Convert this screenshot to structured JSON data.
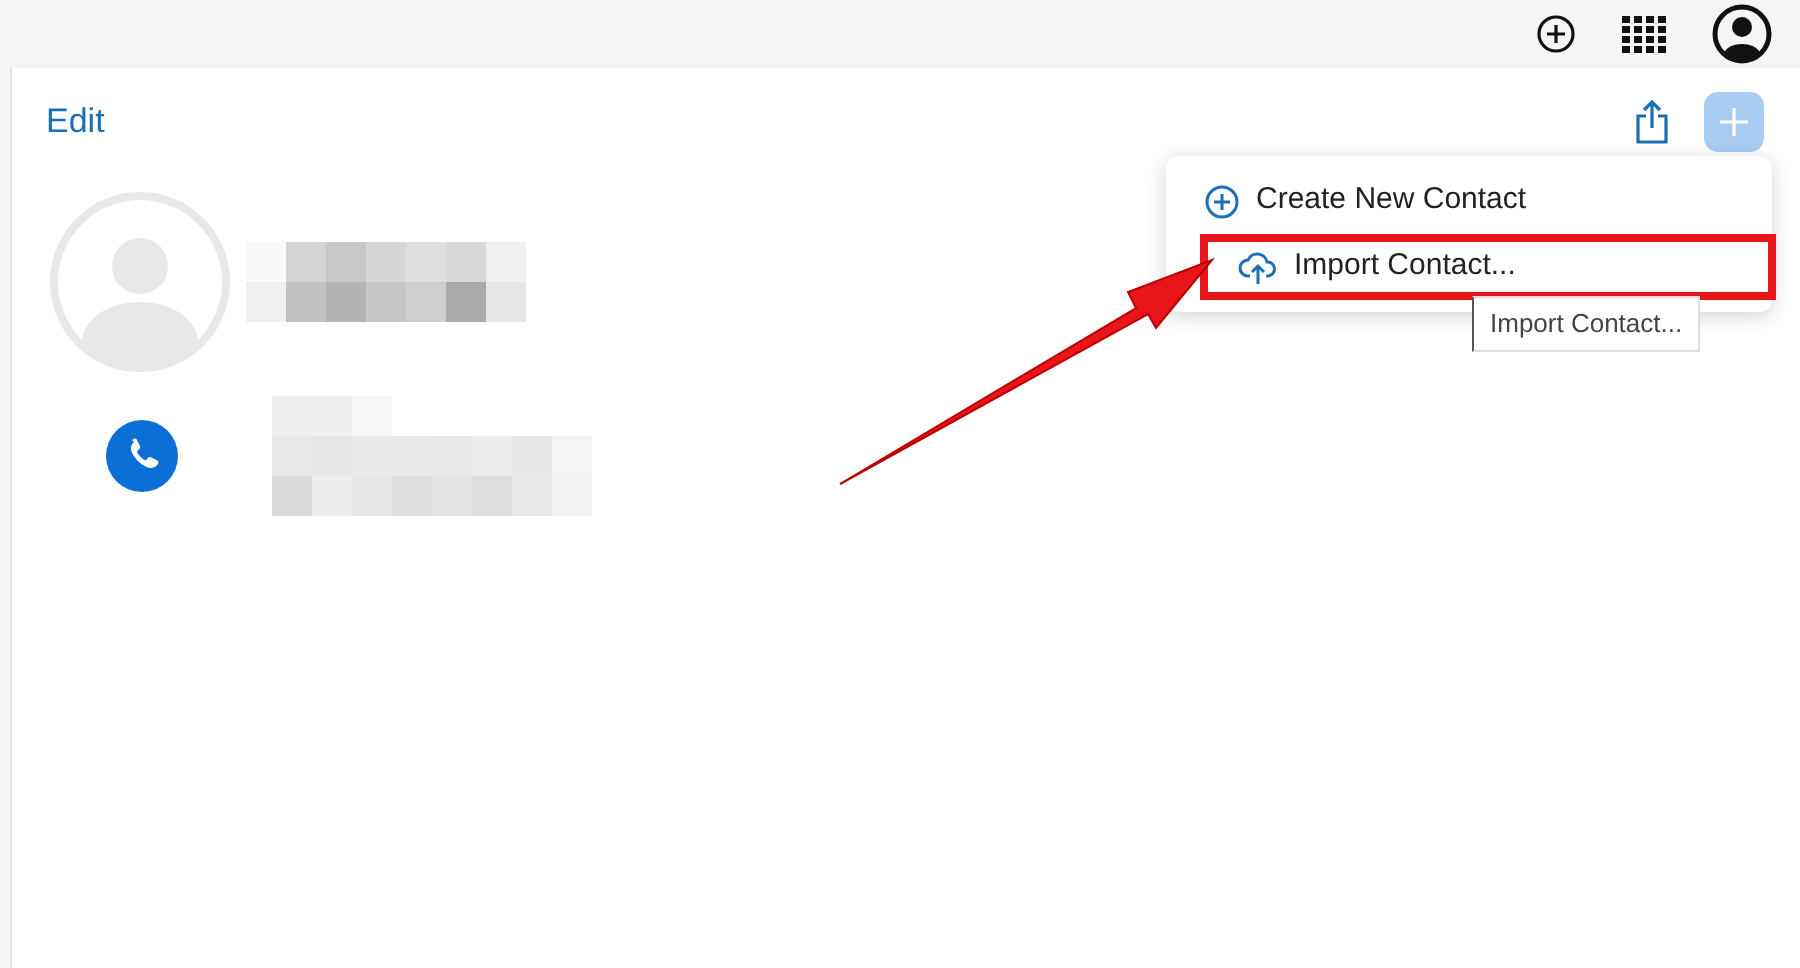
{
  "toolbar": {
    "edit_label": "Edit"
  },
  "menu": {
    "items": [
      {
        "label": "Create New Contact",
        "kind": "add",
        "annotated": false
      },
      {
        "label": "Import Contact...",
        "kind": "upload",
        "annotated": true
      }
    ]
  },
  "tooltip": "Import Contact..."
}
